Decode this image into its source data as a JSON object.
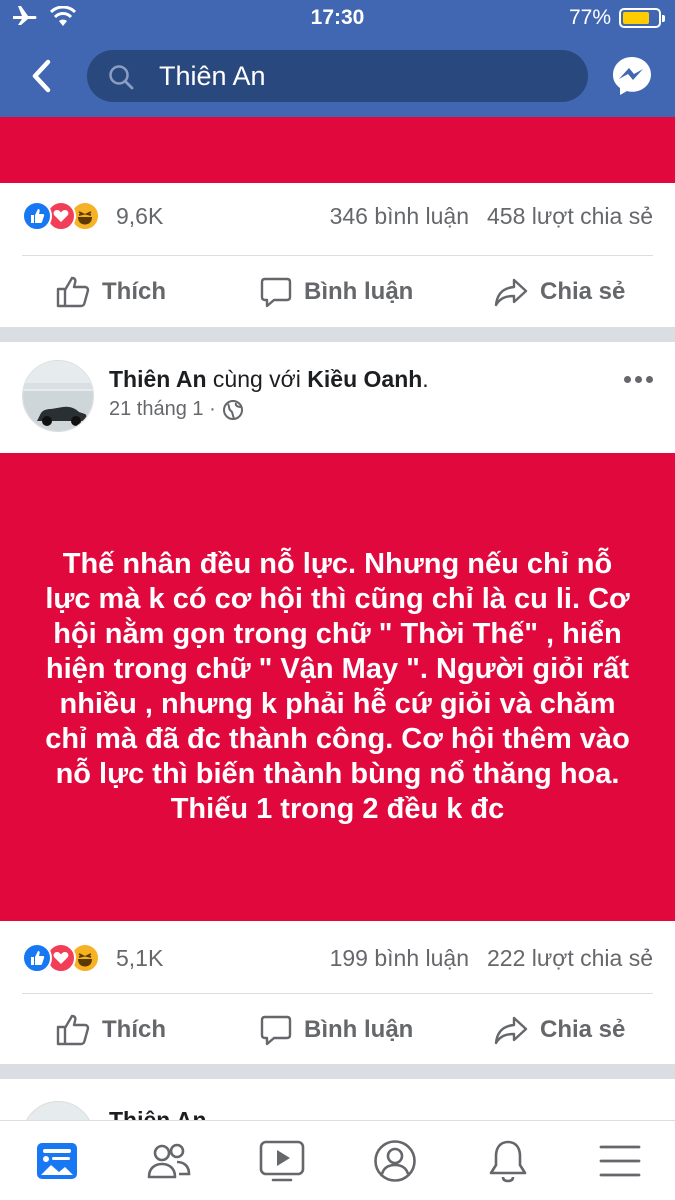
{
  "status_bar": {
    "time": "17:30",
    "battery": "77%",
    "battery_level": 0.77
  },
  "header": {
    "search_text": "Thiên An"
  },
  "post1": {
    "reaction_count": "9,6K",
    "comments": "346 bình luận",
    "shares": "458 lượt chia sẻ"
  },
  "post2": {
    "author": "Thiên An",
    "with_word": " cùng với ",
    "tagged": "Kiều Oanh",
    "tagged_suffix": ".",
    "date": "21 tháng 1 ·",
    "text": "Thế nhân đều nỗ lực. Nhưng nếu chỉ nỗ lực mà k có cơ hội thì cũng chỉ là cu li. Cơ hội nằm gọn trong chữ \" Thời Thế\" , hiển hiện trong chữ \" Vận May  \". Người giỏi rất nhiều , nhưng k phải hễ cứ giỏi và chăm chỉ mà đã đc thành công. Cơ hội thêm vào nỗ lực thì biến thành bùng nổ thăng hoa. Thiếu 1 trong 2 đều k đc",
    "reaction_count": "5,1K",
    "comments": "199 bình luận",
    "shares": "222 lượt chia sẻ"
  },
  "post3": {
    "author": "Thiên An"
  },
  "actions": {
    "like": "Thích",
    "comment": "Bình luận",
    "share": "Chia sẻ"
  },
  "colors": {
    "header": "#4267b2",
    "post_background": "#e0083d",
    "muted_text": "#65676b"
  },
  "icons": [
    "airplane-icon",
    "wifi-icon",
    "back-icon",
    "search-icon",
    "messenger-icon",
    "globe-icon",
    "like-icon",
    "comment-icon",
    "share-icon",
    "news-feed-icon",
    "friends-icon",
    "watch-icon",
    "profile-icon",
    "bell-icon",
    "menu-icon"
  ]
}
